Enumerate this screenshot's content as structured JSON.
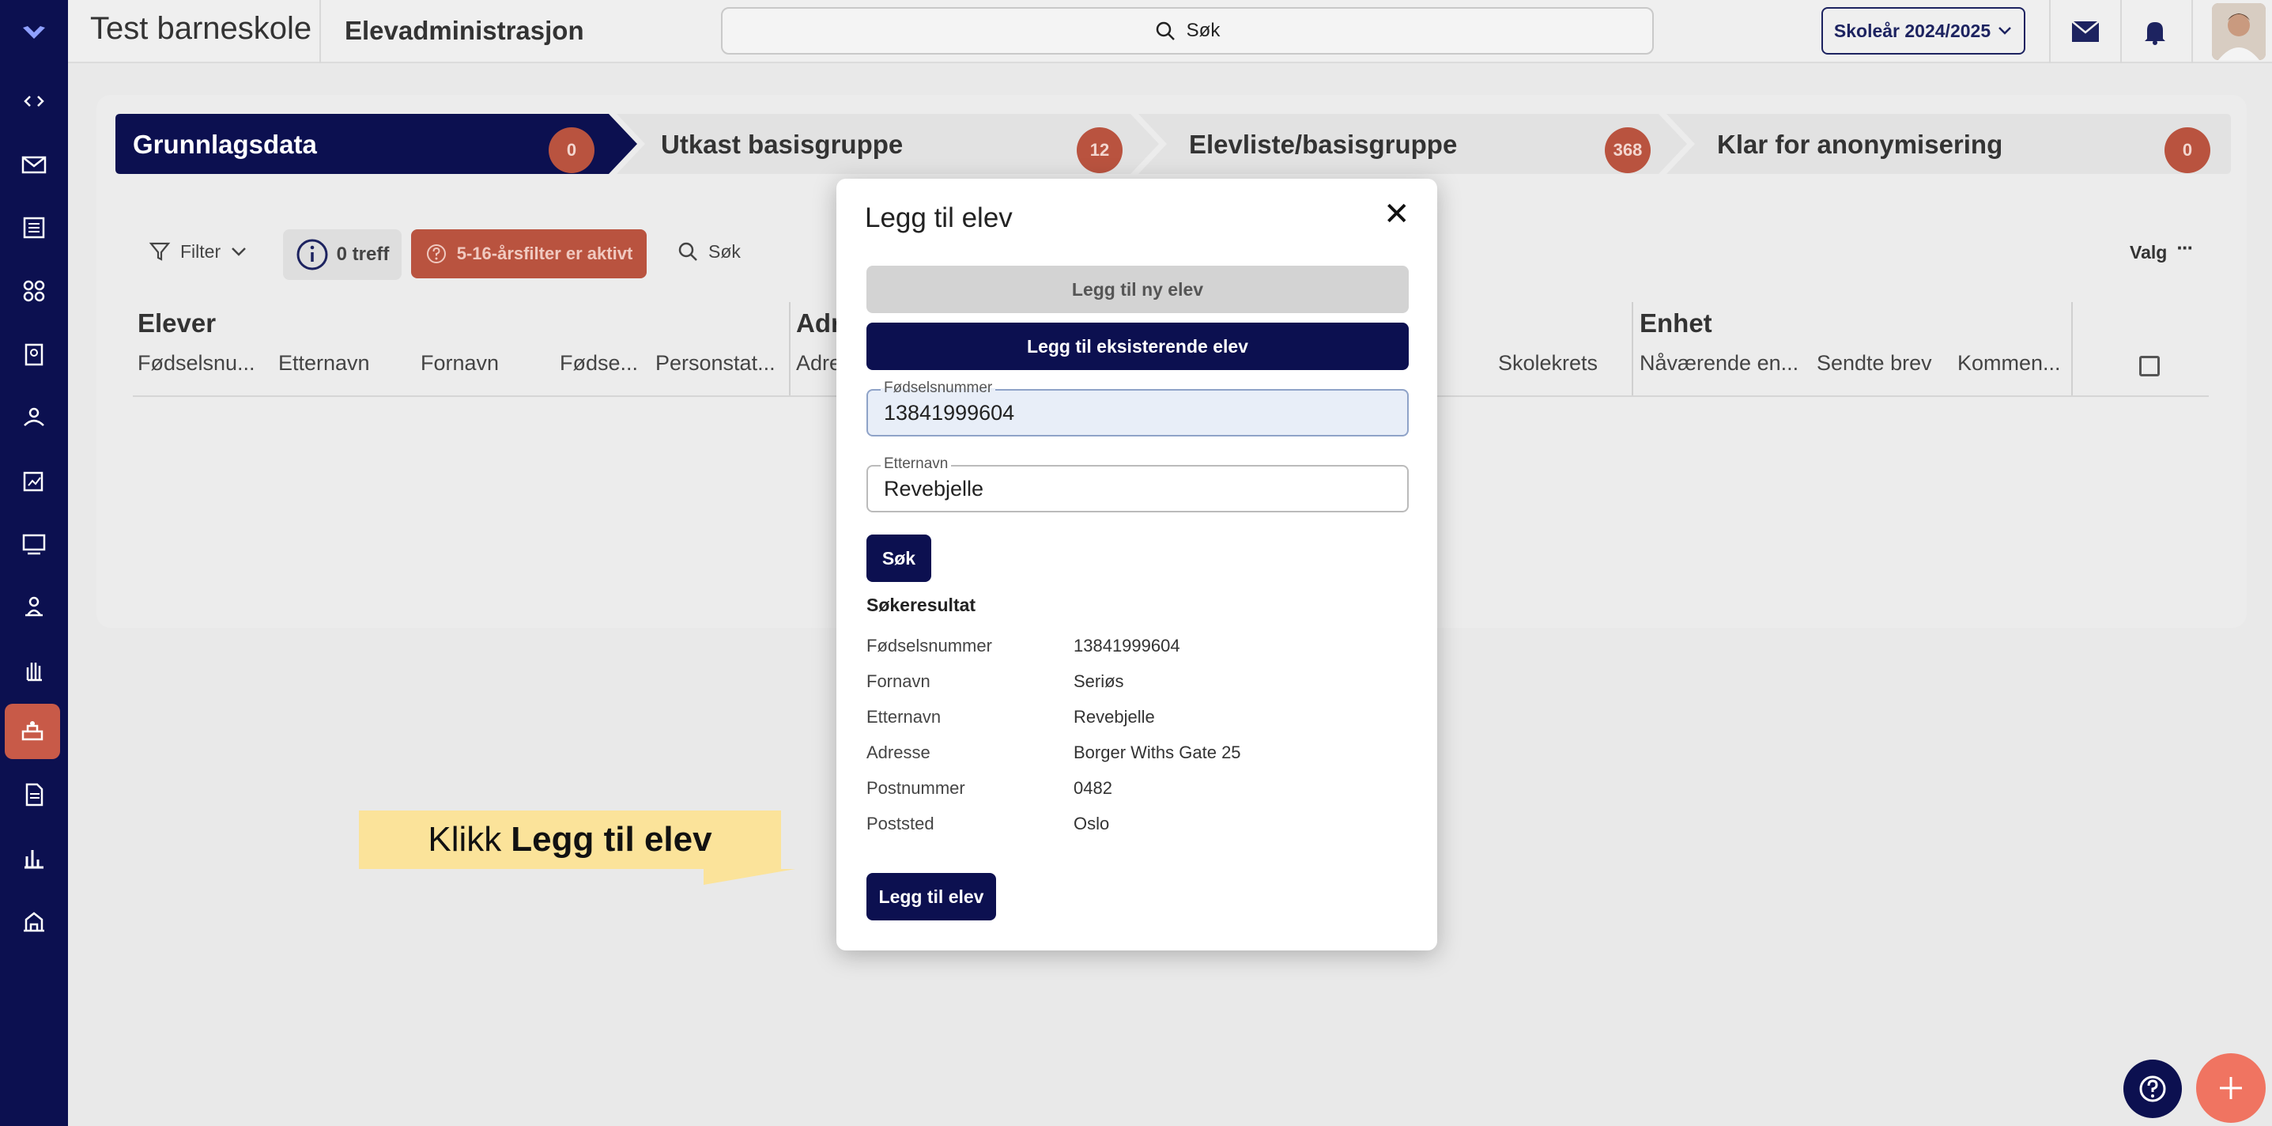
{
  "app": {
    "school_name": "Test barneskole",
    "module_title": "Elevadministrasjon",
    "search_label": "Søk",
    "school_year": "Skoleår 2024/2025"
  },
  "sidebar": {
    "items": [
      {
        "icon": "code-icon"
      },
      {
        "icon": "mail-icon"
      },
      {
        "icon": "news-icon"
      },
      {
        "icon": "groups-icon"
      },
      {
        "icon": "badge-icon"
      },
      {
        "icon": "people-icon"
      },
      {
        "icon": "report-icon"
      },
      {
        "icon": "classroom-icon"
      },
      {
        "icon": "teacher-icon"
      },
      {
        "icon": "hand-icon"
      },
      {
        "icon": "student-admin-icon",
        "active": true
      },
      {
        "icon": "document-icon"
      },
      {
        "icon": "chart-icon"
      },
      {
        "icon": "school-icon"
      }
    ]
  },
  "steps": [
    {
      "label": "Grunnlagsdata",
      "count": "0"
    },
    {
      "label": "Utkast basisgruppe",
      "count": "12"
    },
    {
      "label": "Elevliste/basisgruppe",
      "count": "368"
    },
    {
      "label": "Klar for anonymisering",
      "count": "0"
    }
  ],
  "toolbar": {
    "filter_label": "Filter",
    "hits_label": "0 treff",
    "age_filter_label": "5-16-årsfilter er aktivt",
    "search_label": "Søk",
    "options_label": "Valg"
  },
  "table": {
    "groups": {
      "elever": "Elever",
      "adresse": "Adr",
      "enhet": "Enhet"
    },
    "columns": {
      "fodselsnummer": "Fødselsnu...",
      "etternavn": "Etternavn",
      "fornavn": "Fornavn",
      "fodselsdato": "Fødse...",
      "personstatus": "Personstat...",
      "adresse": "Adre",
      "skolekrets": "Skolekrets",
      "navaerende_enhet": "Nåværende en...",
      "sendte_brev": "Sendte brev",
      "kommentar": "Kommen..."
    }
  },
  "modal": {
    "title": "Legg til elev",
    "close": "✕",
    "btn_new": "Legg til ny elev",
    "btn_existing": "Legg til eksisterende elev",
    "field_fnr_label": "Fødselsnummer",
    "field_fnr_value": "13841999604",
    "field_lastname_label": "Etternavn",
    "field_lastname_value": "Revebjelle",
    "search_button": "Søk",
    "result_heading": "Søkeresultat",
    "results": [
      {
        "key": "Fødselsnummer",
        "value": "13841999604"
      },
      {
        "key": "Fornavn",
        "value": "Seriøs"
      },
      {
        "key": "Etternavn",
        "value": "Revebjelle"
      },
      {
        "key": "Adresse",
        "value": "Borger Withs Gate 25"
      },
      {
        "key": "Postnummer",
        "value": "0482"
      },
      {
        "key": "Poststed",
        "value": "Oslo"
      }
    ],
    "add_button": "Legg til elev"
  },
  "callout": {
    "prefix": "Klikk",
    "bold": "Legg til elev"
  },
  "colors": {
    "navy": "#0c1050",
    "badge_red": "#b9533f",
    "fab_coral": "#f07461",
    "callout_yellow": "#fbe39a"
  }
}
